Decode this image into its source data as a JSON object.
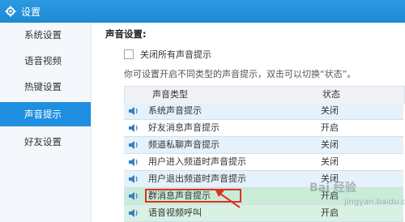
{
  "window": {
    "title": "设置"
  },
  "sidebar": {
    "items": [
      {
        "label": "系统设置"
      },
      {
        "label": "语音视频"
      },
      {
        "label": "热键设置"
      },
      {
        "label": "声音提示"
      },
      {
        "label": "好友设置"
      }
    ],
    "active_index": 3
  },
  "content": {
    "section_title": "声音设置:",
    "disable_all_label": "关闭所有声音提示",
    "description": "你可设置开启不同类型的声音提示，双击可以切换“状态”。",
    "columns": {
      "type": "声音类型",
      "state": "状态"
    },
    "rows": [
      {
        "name": "系统声音提示",
        "state": "关闭"
      },
      {
        "name": "好友消息声音提示",
        "state": "开启"
      },
      {
        "name": "频道私聊声音提示",
        "state": "关闭"
      },
      {
        "name": "用户进入频道时声音提示",
        "state": "关闭"
      },
      {
        "name": "用户退出频道时声音提示",
        "state": "关闭"
      },
      {
        "name": "群消息声音提示",
        "state": "开启"
      },
      {
        "name": "语音视频呼叫",
        "state": "开启"
      }
    ]
  },
  "watermark": {
    "text": "Bai 经验",
    "sub": "jingyan.baidu.com"
  },
  "colors": {
    "accent": "#1e8fe0",
    "highlight_row": "#c9ecd9",
    "callout": "#e0301e"
  }
}
